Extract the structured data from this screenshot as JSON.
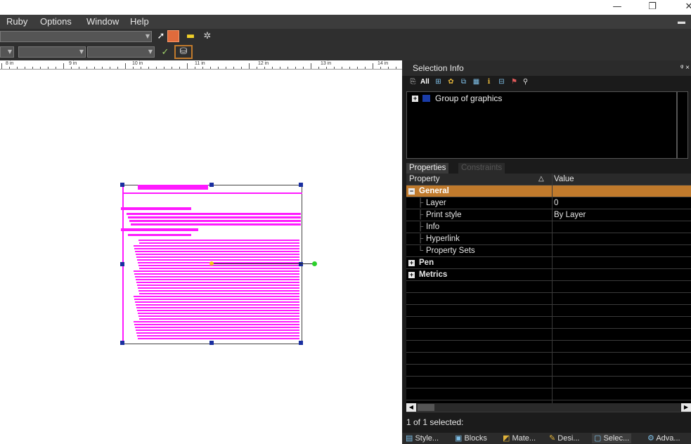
{
  "window": {
    "minimize_glyph": "—",
    "restore_glyph": "❐",
    "close_glyph": "✕"
  },
  "menu": {
    "items": [
      "Ruby",
      "Options",
      "Window",
      "Help"
    ],
    "pin_glyph": "▬"
  },
  "toolbar": {
    "icons": [
      "select-arrow-icon",
      "square-icon",
      "layer-icon",
      "tool-icon"
    ],
    "row2_icons": [
      "pen-check-icon",
      "database-icon"
    ]
  },
  "ruler": {
    "labels": [
      "8 in",
      "9 in",
      "10 in",
      "11 in",
      "12 in",
      "13 in",
      "14 in"
    ]
  },
  "panel": {
    "title": "Selection Info",
    "pin_close": "ᵠ ×",
    "toolbar_all": "All",
    "tree_item": "Group of graphics",
    "tabs": [
      "Properties",
      "Constraints"
    ],
    "col_property": "Property",
    "col_value": "Value",
    "sort_glyph": "△",
    "rows": [
      {
        "label": "General",
        "value": ""
      },
      {
        "label": "Layer",
        "value": "0"
      },
      {
        "label": "Print style",
        "value": "By Layer"
      },
      {
        "label": "Info",
        "value": ""
      },
      {
        "label": "Hyperlink",
        "value": ""
      },
      {
        "label": "Property Sets",
        "value": ""
      },
      {
        "label": "Pen",
        "value": ""
      },
      {
        "label": "Metrics",
        "value": ""
      }
    ],
    "status": "1 of 1 selected:"
  },
  "bottom_tabs": [
    "Style...",
    "Blocks",
    "Mate...",
    "Desi...",
    "Selec...",
    "Adva..."
  ],
  "colors": {
    "accent_orange": "#c07a2c",
    "magenta": "#ff1aff",
    "handle": "#1a2fa0"
  }
}
